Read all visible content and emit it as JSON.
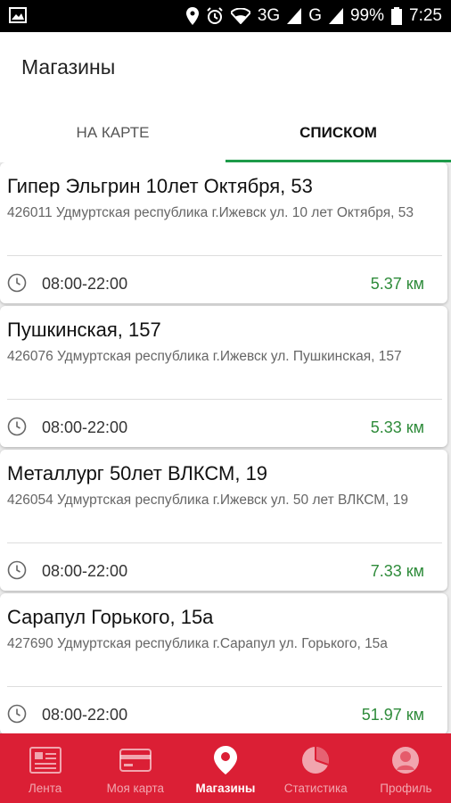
{
  "status_bar": {
    "network": "3G",
    "carrier": "G",
    "battery": "99%",
    "time": "7:25"
  },
  "header": {
    "title": "Магазины"
  },
  "tabs": [
    {
      "label": "НА КАРТЕ"
    },
    {
      "label": "СПИСКОМ"
    }
  ],
  "stores": [
    {
      "name": "Гипер Эльгрин 10лет Октября, 53",
      "address": "426011 Удмуртская республика г.Ижевск ул. 10 лет Октября, 53",
      "hours": "08:00-22:00",
      "distance": "5.37 км"
    },
    {
      "name": "Пушкинская, 157",
      "address": "426076 Удмуртская республика г.Ижевск ул. Пушкинская, 157",
      "hours": "08:00-22:00",
      "distance": "5.33 км"
    },
    {
      "name": "Металлург 50лет ВЛКСМ, 19",
      "address": "426054 Удмуртская республика г.Ижевск ул. 50 лет ВЛКСМ, 19",
      "hours": "08:00-22:00",
      "distance": "7.33 км"
    },
    {
      "name": "Сарапул Горького, 15а",
      "address": "427690 Удмуртская республика г.Сарапул ул. Горького, 15а",
      "hours": "08:00-22:00",
      "distance": "51.97 км"
    }
  ],
  "bottom_nav": [
    {
      "label": "Лента",
      "icon": "feed-icon"
    },
    {
      "label": "Моя карта",
      "icon": "card-icon"
    },
    {
      "label": "Магазины",
      "icon": "location-pin-icon"
    },
    {
      "label": "Статистика",
      "icon": "pie-chart-icon"
    },
    {
      "label": "Профиль",
      "icon": "profile-icon"
    }
  ],
  "colors": {
    "accent": "#1e9b4a",
    "distance": "#2e8b3a",
    "nav_bg": "#db1f35"
  }
}
